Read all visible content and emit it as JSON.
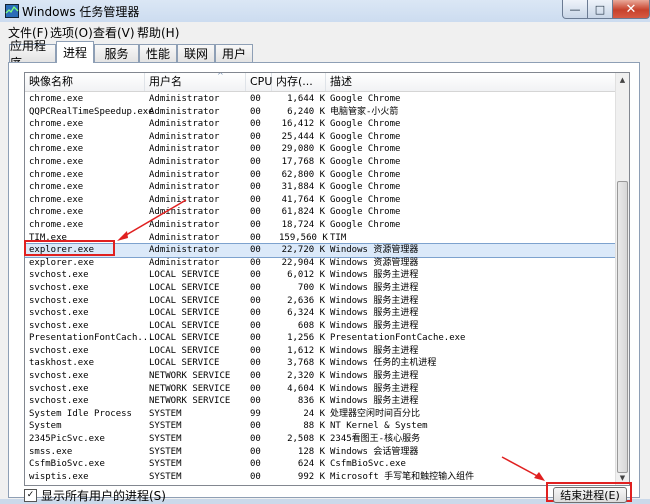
{
  "window": {
    "title": "Windows 任务管理器",
    "minimize": "—",
    "maximize": "□",
    "close": "✕"
  },
  "menu": [
    "文件(F)",
    "选项(O)",
    "查看(V)",
    "帮助(H)"
  ],
  "tabs": [
    "应用程序",
    "进程",
    "服务",
    "性能",
    "联网",
    "用户"
  ],
  "active_tab": "进程",
  "columns": {
    "name": "映像名称",
    "user": "用户名",
    "cpu": "CPU",
    "mem": "内存(...",
    "desc": "描述"
  },
  "rows": [
    {
      "name": "chrome.exe",
      "user": "Administrator",
      "cpu": "00",
      "mem": "1,644 K",
      "desc": "Google Chrome"
    },
    {
      "name": "QQPCRealTimeSpeedup.exe",
      "user": "Administrator",
      "cpu": "00",
      "mem": "6,240 K",
      "desc": "电脑管家-小火箭"
    },
    {
      "name": "chrome.exe",
      "user": "Administrator",
      "cpu": "00",
      "mem": "16,412 K",
      "desc": "Google Chrome"
    },
    {
      "name": "chrome.exe",
      "user": "Administrator",
      "cpu": "00",
      "mem": "25,444 K",
      "desc": "Google Chrome"
    },
    {
      "name": "chrome.exe",
      "user": "Administrator",
      "cpu": "00",
      "mem": "29,080 K",
      "desc": "Google Chrome"
    },
    {
      "name": "chrome.exe",
      "user": "Administrator",
      "cpu": "00",
      "mem": "17,768 K",
      "desc": "Google Chrome"
    },
    {
      "name": "chrome.exe",
      "user": "Administrator",
      "cpu": "00",
      "mem": "62,800 K",
      "desc": "Google Chrome"
    },
    {
      "name": "chrome.exe",
      "user": "Administrator",
      "cpu": "00",
      "mem": "31,884 K",
      "desc": "Google Chrome"
    },
    {
      "name": "chrome.exe",
      "user": "Administrator",
      "cpu": "00",
      "mem": "41,764 K",
      "desc": "Google Chrome"
    },
    {
      "name": "chrome.exe",
      "user": "Administrator",
      "cpu": "00",
      "mem": "61,824 K",
      "desc": "Google Chrome"
    },
    {
      "name": "chrome.exe",
      "user": "Administrator",
      "cpu": "00",
      "mem": "18,724 K",
      "desc": "Google Chrome"
    },
    {
      "name": "TIM.exe",
      "user": "Administrator",
      "cpu": "00",
      "mem": "159,560 K",
      "desc": "TIM"
    },
    {
      "name": "explorer.exe",
      "user": "Administrator",
      "cpu": "00",
      "mem": "22,720 K",
      "desc": "Windows 资源管理器",
      "selected": true
    },
    {
      "name": "explorer.exe",
      "user": "Administrator",
      "cpu": "00",
      "mem": "22,904 K",
      "desc": "Windows 资源管理器"
    },
    {
      "name": "svchost.exe",
      "user": "LOCAL SERVICE",
      "cpu": "00",
      "mem": "6,012 K",
      "desc": "Windows 服务主进程"
    },
    {
      "name": "svchost.exe",
      "user": "LOCAL SERVICE",
      "cpu": "00",
      "mem": "700 K",
      "desc": "Windows 服务主进程"
    },
    {
      "name": "svchost.exe",
      "user": "LOCAL SERVICE",
      "cpu": "00",
      "mem": "2,636 K",
      "desc": "Windows 服务主进程"
    },
    {
      "name": "svchost.exe",
      "user": "LOCAL SERVICE",
      "cpu": "00",
      "mem": "6,324 K",
      "desc": "Windows 服务主进程"
    },
    {
      "name": "svchost.exe",
      "user": "LOCAL SERVICE",
      "cpu": "00",
      "mem": "608 K",
      "desc": "Windows 服务主进程"
    },
    {
      "name": "PresentationFontCach...",
      "user": "LOCAL SERVICE",
      "cpu": "00",
      "mem": "1,256 K",
      "desc": "PresentationFontCache.exe"
    },
    {
      "name": "svchost.exe",
      "user": "LOCAL SERVICE",
      "cpu": "00",
      "mem": "1,612 K",
      "desc": "Windows 服务主进程"
    },
    {
      "name": "taskhost.exe",
      "user": "LOCAL SERVICE",
      "cpu": "00",
      "mem": "3,768 K",
      "desc": "Windows 任务的主机进程"
    },
    {
      "name": "svchost.exe",
      "user": "NETWORK SERVICE",
      "cpu": "00",
      "mem": "2,320 K",
      "desc": "Windows 服务主进程"
    },
    {
      "name": "svchost.exe",
      "user": "NETWORK SERVICE",
      "cpu": "00",
      "mem": "4,604 K",
      "desc": "Windows 服务主进程"
    },
    {
      "name": "svchost.exe",
      "user": "NETWORK SERVICE",
      "cpu": "00",
      "mem": "836 K",
      "desc": "Windows 服务主进程"
    },
    {
      "name": "System Idle Process",
      "user": "SYSTEM",
      "cpu": "99",
      "mem": "24 K",
      "desc": "处理器空闲时间百分比"
    },
    {
      "name": "System",
      "user": "SYSTEM",
      "cpu": "00",
      "mem": "88 K",
      "desc": "NT Kernel & System"
    },
    {
      "name": "2345PicSvc.exe",
      "user": "SYSTEM",
      "cpu": "00",
      "mem": "2,508 K",
      "desc": "2345看图王-核心服务"
    },
    {
      "name": "smss.exe",
      "user": "SYSTEM",
      "cpu": "00",
      "mem": "128 K",
      "desc": "Windows 会话管理器"
    },
    {
      "name": "CsfmBioSvc.exe",
      "user": "SYSTEM",
      "cpu": "00",
      "mem": "624 K",
      "desc": "CsfmBioSvc.exe"
    },
    {
      "name": "wisptis.exe",
      "user": "SYSTEM",
      "cpu": "00",
      "mem": "992 K",
      "desc": "Microsoft 手写笔和触控输入组件"
    }
  ],
  "show_all_label": "显示所有用户的进程(S)",
  "show_all_checked": true,
  "end_process_label": "结束进程(E)",
  "annotation_color": "#e02020"
}
